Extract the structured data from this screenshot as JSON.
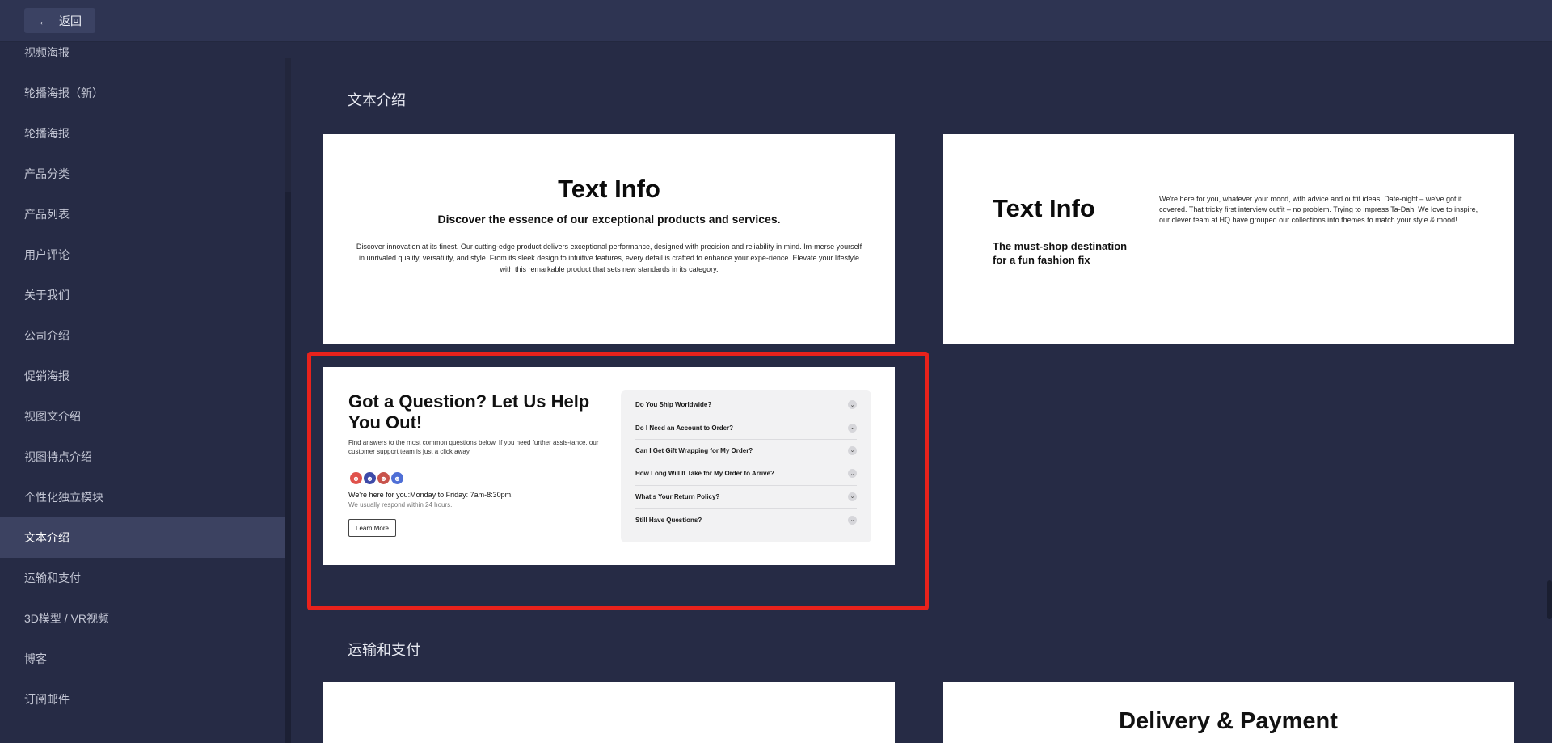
{
  "header": {
    "back_label": "返回",
    "back_icon": "←"
  },
  "sidebar": {
    "items": [
      {
        "label": "视频海报"
      },
      {
        "label": "轮播海报（新）"
      },
      {
        "label": "轮播海报"
      },
      {
        "label": "产品分类"
      },
      {
        "label": "产品列表"
      },
      {
        "label": "用户评论"
      },
      {
        "label": "关于我们"
      },
      {
        "label": "公司介绍"
      },
      {
        "label": "促销海报"
      },
      {
        "label": "视图文介绍"
      },
      {
        "label": "视图特点介绍"
      },
      {
        "label": "个性化独立模块"
      },
      {
        "label": "文本介绍"
      },
      {
        "label": "运输和支付"
      },
      {
        "label": "3D模型 / VR视频"
      },
      {
        "label": "博客"
      },
      {
        "label": "订阅邮件"
      }
    ],
    "active_label": "文本介绍"
  },
  "sections": [
    {
      "title": "文本介绍",
      "cards": [
        {
          "title": "Text Info",
          "subtitle": "Discover the essence of our exceptional products and services.",
          "body": "Discover innovation at its finest. Our cutting-edge product delivers exceptional performance, designed with precision and reliability in mind. Im-merse yourself in unrivaled quality, versatility, and style. From its sleek design to intuitive features, every detail is crafted to enhance your expe-rience. Elevate your lifestyle with this remarkable product that sets new standards in its category."
        },
        {
          "title": "Text Info",
          "subtitle": "The must-shop destination for a fun fashion fix",
          "body": "We're here for you, whatever your mood, with advice and outfit ideas. Date-night – we've got it covered. That tricky first interview outfit – no problem. Trying to impress Ta-Dah! We love to inspire, our clever team at HQ have grouped our collections into themes to match your style & mood!"
        },
        {
          "title": "Got a Question? Let Us Help You Out!",
          "description": "Find answers to the most common questions below. If you need further assis-tance, our customer support team is just a click away.",
          "hours": "We're here for you:Monday to Friday: 7am-8:30pm.",
          "respond": "We usually respond within 24 hours.",
          "button": "Learn More",
          "avatar_colors": [
            "#e0524b",
            "#3e4aa8",
            "#c8534c",
            "#4f6fd6"
          ],
          "faq": [
            "Do You Ship Worldwide?",
            "Do I Need an Account to Order?",
            "Can I Get Gift Wrapping for My Order?",
            "How Long Will It Take for My Order to Arrive?",
            "What's Your Return Policy?",
            "Still Have Questions?"
          ]
        }
      ]
    },
    {
      "title": "运输和支付",
      "cards": [
        {
          "title": ""
        },
        {
          "title": "Delivery & Payment"
        }
      ]
    }
  ],
  "highlight_color": "#e8221c"
}
